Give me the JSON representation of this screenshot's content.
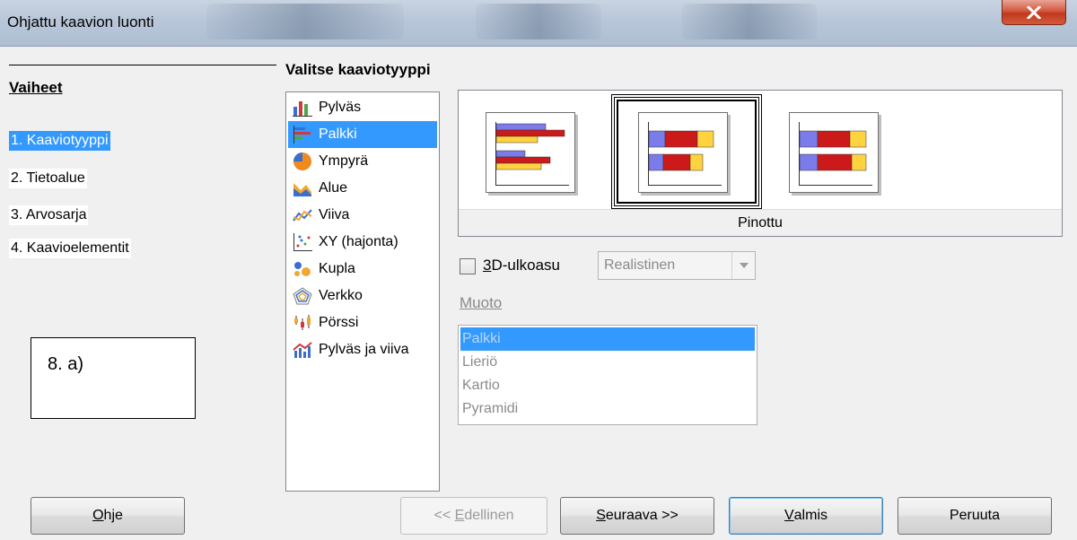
{
  "window": {
    "title": "Ohjattu kaavion luonti",
    "close_glyph": "X"
  },
  "steps": {
    "title": "Vaiheet",
    "items": [
      {
        "label": "1. Kaaviotyyppi",
        "active": true
      },
      {
        "label": "2. Tietoalue",
        "active": false
      },
      {
        "label": "3. Arvosarja",
        "active": false
      },
      {
        "label": "4. Kaavioelementit",
        "active": false
      }
    ]
  },
  "annotation": {
    "text": "8. a)"
  },
  "chart_types": {
    "title": "Valitse kaaviotyyppi",
    "items": [
      {
        "label": "Pylväs",
        "icon": "column-chart-icon"
      },
      {
        "label": "Palkki",
        "icon": "bar-chart-icon",
        "selected": true
      },
      {
        "label": "Ympyrä",
        "icon": "pie-chart-icon"
      },
      {
        "label": "Alue",
        "icon": "area-chart-icon"
      },
      {
        "label": "Viiva",
        "icon": "line-chart-icon"
      },
      {
        "label": "XY (hajonta)",
        "icon": "scatter-chart-icon"
      },
      {
        "label": "Kupla",
        "icon": "bubble-chart-icon"
      },
      {
        "label": "Verkko",
        "icon": "net-chart-icon"
      },
      {
        "label": "Pörssi",
        "icon": "stock-chart-icon"
      },
      {
        "label": "Pylväs ja viiva",
        "icon": "column-line-chart-icon"
      }
    ]
  },
  "variants": {
    "selected_caption": "Pinottu",
    "items": [
      "normal-bar-variant-icon",
      "stacked-bar-variant-icon",
      "percent-stacked-bar-variant-icon"
    ],
    "selected_index": 1
  },
  "options": {
    "three_d_label_accel": "3",
    "three_d_label_rest": "D-ulkoasu",
    "three_d_checked": false,
    "three_d_style": "Realistinen",
    "shape_label": "Muoto",
    "shapes": [
      "Palkki",
      "Lieriö",
      "Kartio",
      "Pyramidi"
    ],
    "shape_selected_index": 0
  },
  "buttons": {
    "help": {
      "accel": "O",
      "rest": "hje"
    },
    "back": {
      "prefix": "<< ",
      "accel": "E",
      "rest": "dellinen"
    },
    "next": {
      "accel": "S",
      "rest": "euraava >>"
    },
    "finish": {
      "accel": "V",
      "rest": "almis"
    },
    "cancel": "Peruuta"
  },
  "colors": {
    "selection": "#3399ff",
    "bar_blue": "#7b7bea",
    "bar_red": "#cc1a1a",
    "bar_yellow": "#ffd23f"
  }
}
